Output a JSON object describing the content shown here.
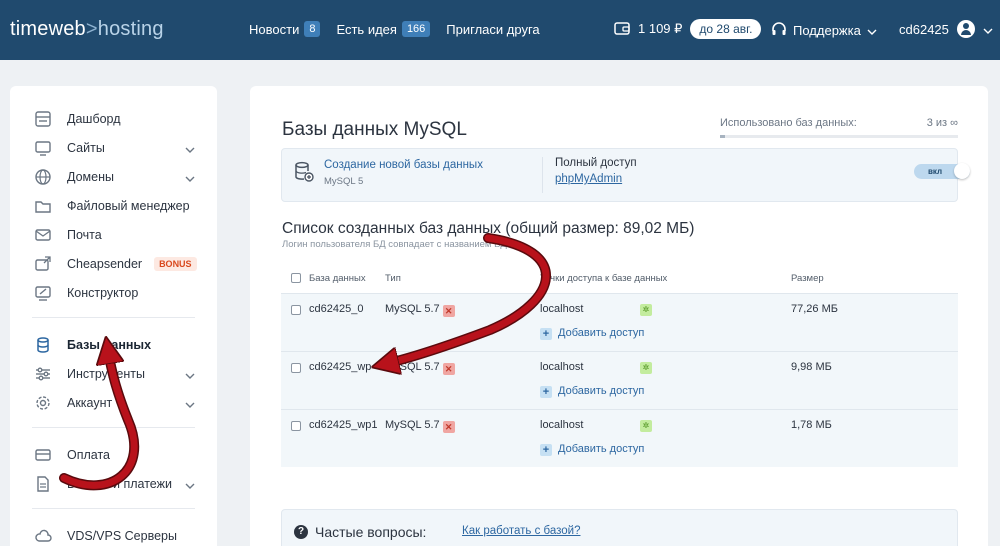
{
  "header": {
    "logo_part1": "timeweb",
    "logo_sep": ">",
    "logo_part2": "hosting",
    "nav": [
      {
        "label": "Новости",
        "badge": "8"
      },
      {
        "label": "Есть идея",
        "badge": "166"
      },
      {
        "label": "Пригласи друга"
      }
    ],
    "balance": "1 109 ₽",
    "paid_until": "до 28 авг.",
    "support": "Поддержка",
    "username": "cd62425"
  },
  "sidebar": {
    "items": [
      {
        "label": "Дашборд"
      },
      {
        "label": "Сайты"
      },
      {
        "label": "Домены"
      },
      {
        "label": "Файловый менеджер"
      },
      {
        "label": "Почта"
      },
      {
        "label": "Cheapsender",
        "badge": "BONUS"
      },
      {
        "label": "Конструктор"
      },
      {
        "label": "Базы данных"
      },
      {
        "label": "Инструменты"
      },
      {
        "label": "Аккаунт"
      },
      {
        "label": "Оплата"
      },
      {
        "label": "Баланс и платежи"
      },
      {
        "label": "VDS/VPS Серверы"
      }
    ]
  },
  "main": {
    "title": "Базы данных MySQL",
    "usage_label": "Использовано баз данных:",
    "usage_value": "3 из ∞",
    "create_title": "Создание новой базы данных",
    "create_sub": "MySQL 5",
    "full_access_label": "Полный доступ",
    "phpmyadmin": "phpMyAdmin",
    "toggle_label": "вкл",
    "list_title": "Список созданных баз данных (общий размер: 89,02 МБ)",
    "list_sub": "Логин пользователя БД совпадает с названием БД",
    "columns": {
      "name": "База данных",
      "type": "Тип",
      "access": "Точки доступа к базе данных",
      "size": "Размер"
    },
    "rows": [
      {
        "name": "cd62425_0",
        "type": "MySQL 5.7",
        "host": "localhost",
        "add": "Добавить доступ",
        "size": "77,26 МБ"
      },
      {
        "name": "cd62425_wp",
        "type": "MySQL 5.7",
        "host": "localhost",
        "add": "Добавить доступ",
        "size": "9,98 МБ"
      },
      {
        "name": "cd62425_wp1",
        "type": "MySQL 5.7",
        "host": "localhost",
        "add": "Добавить доступ",
        "size": "1,78 МБ"
      }
    ],
    "faq_label": "Частые вопросы:",
    "faq_link": "Как работать с базой?"
  },
  "colors": {
    "header_bg": "#204a6e",
    "accent": "#2d67a1",
    "annotation_arrow": "#b8121b"
  }
}
